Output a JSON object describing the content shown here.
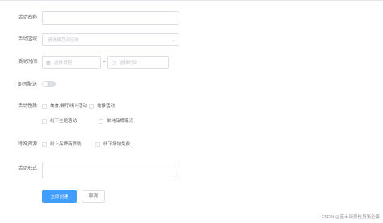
{
  "form": {
    "name": {
      "label": "活动名称",
      "value": ""
    },
    "region": {
      "label": "活动区域",
      "placeholder": "请选择活动区域"
    },
    "time": {
      "label": "活动时间",
      "date_placeholder": "选择日期",
      "separator": "-",
      "time_placeholder": "选择时间"
    },
    "delivery": {
      "label": "即时配送",
      "on": false
    },
    "type": {
      "label": "活动性质",
      "options": [
        "美食/餐厅线上活动",
        "地推活动",
        "线下主题活动",
        "单纯品牌曝光"
      ]
    },
    "resource": {
      "label": "特殊资源",
      "options": [
        "线上品牌商赞助",
        "线下场地免费"
      ]
    },
    "desc": {
      "label": "活动形式",
      "value": ""
    },
    "buttons": {
      "submit": "立即创建",
      "cancel": "取消"
    }
  },
  "watermark": "CSDN @富士康质检员张全蛋",
  "colors": {
    "primary": "#409eff",
    "border": "#dcdfe6",
    "placeholder": "#c0c4cc"
  }
}
